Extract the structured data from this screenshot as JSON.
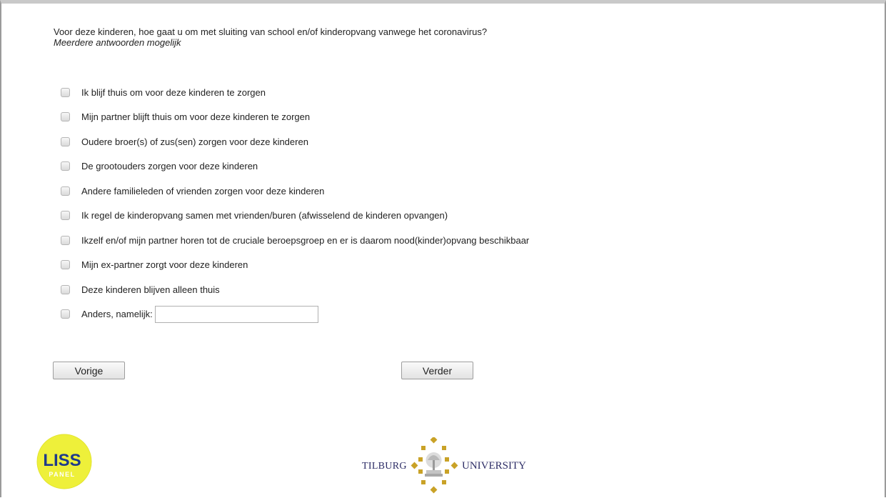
{
  "question": {
    "text": "Voor deze kinderen, hoe gaat u om met sluiting van school en/of kinderopvang vanwege het coronavirus?",
    "subtext": "Meerdere antwoorden mogelijk"
  },
  "options": [
    "Ik blijf thuis om voor deze kinderen te zorgen",
    "Mijn partner blijft thuis om voor deze kinderen te zorgen",
    "Oudere broer(s) of zus(sen) zorgen voor deze kinderen",
    "De grootouders zorgen voor deze kinderen",
    "Andere familieleden of vrienden zorgen voor deze kinderen",
    "Ik regel de kinderopvang samen met vrienden/buren (afwisselend de kinderen opvangen)",
    "Ikzelf en/of mijn partner horen tot de cruciale beroepsgroep en er is daarom nood(kinder)opvang beschikbaar",
    "Mijn ex-partner zorgt voor deze kinderen",
    "Deze kinderen blijven alleen thuis"
  ],
  "other_option": {
    "label": "Anders, namelijk:",
    "value": ""
  },
  "nav": {
    "prev_label": "Vorige",
    "next_label": "Verder"
  },
  "logos": {
    "liss_line1": "LISS",
    "liss_line2": "PANEL",
    "tilburg_left": "TILBURG",
    "tilburg_right": "UNIVERSITY"
  },
  "colors": {
    "liss_yellow": "#eef03a",
    "liss_blue": "#1f3a8a",
    "tilburg_navy": "#2d2d66",
    "tilburg_gold": "#c9a227"
  }
}
